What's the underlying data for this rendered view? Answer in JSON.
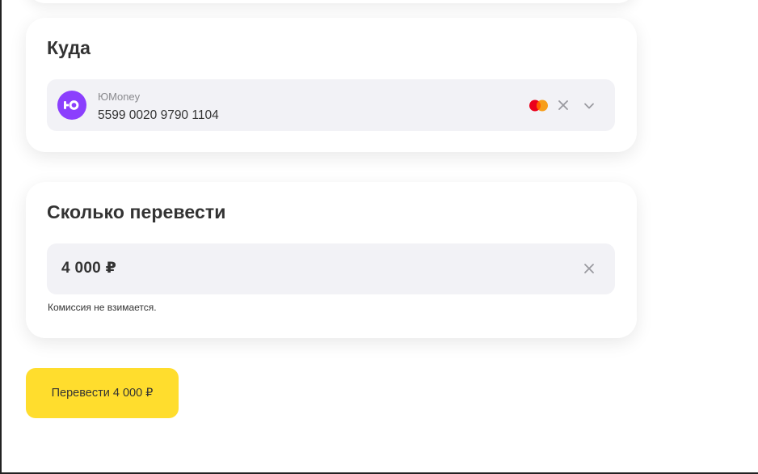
{
  "destination": {
    "title": "Куда",
    "account_label": "ЮMoney",
    "account_number": "5599 0020 9790 1104",
    "logo_icon": "yoomoney-logo-icon",
    "logo_color": "#8b3ffd",
    "card_brand_icon": "mastercard-icon",
    "clear_icon": "close-icon",
    "expand_icon": "chevron-down-icon"
  },
  "amount": {
    "title": "Сколько перевести",
    "value": "4 000 ₽",
    "clear_icon": "close-icon",
    "commission_text": "Комиссия не взимается."
  },
  "submit": {
    "label": "Перевести 4 000 ₽",
    "color": "#ffdd2d"
  }
}
